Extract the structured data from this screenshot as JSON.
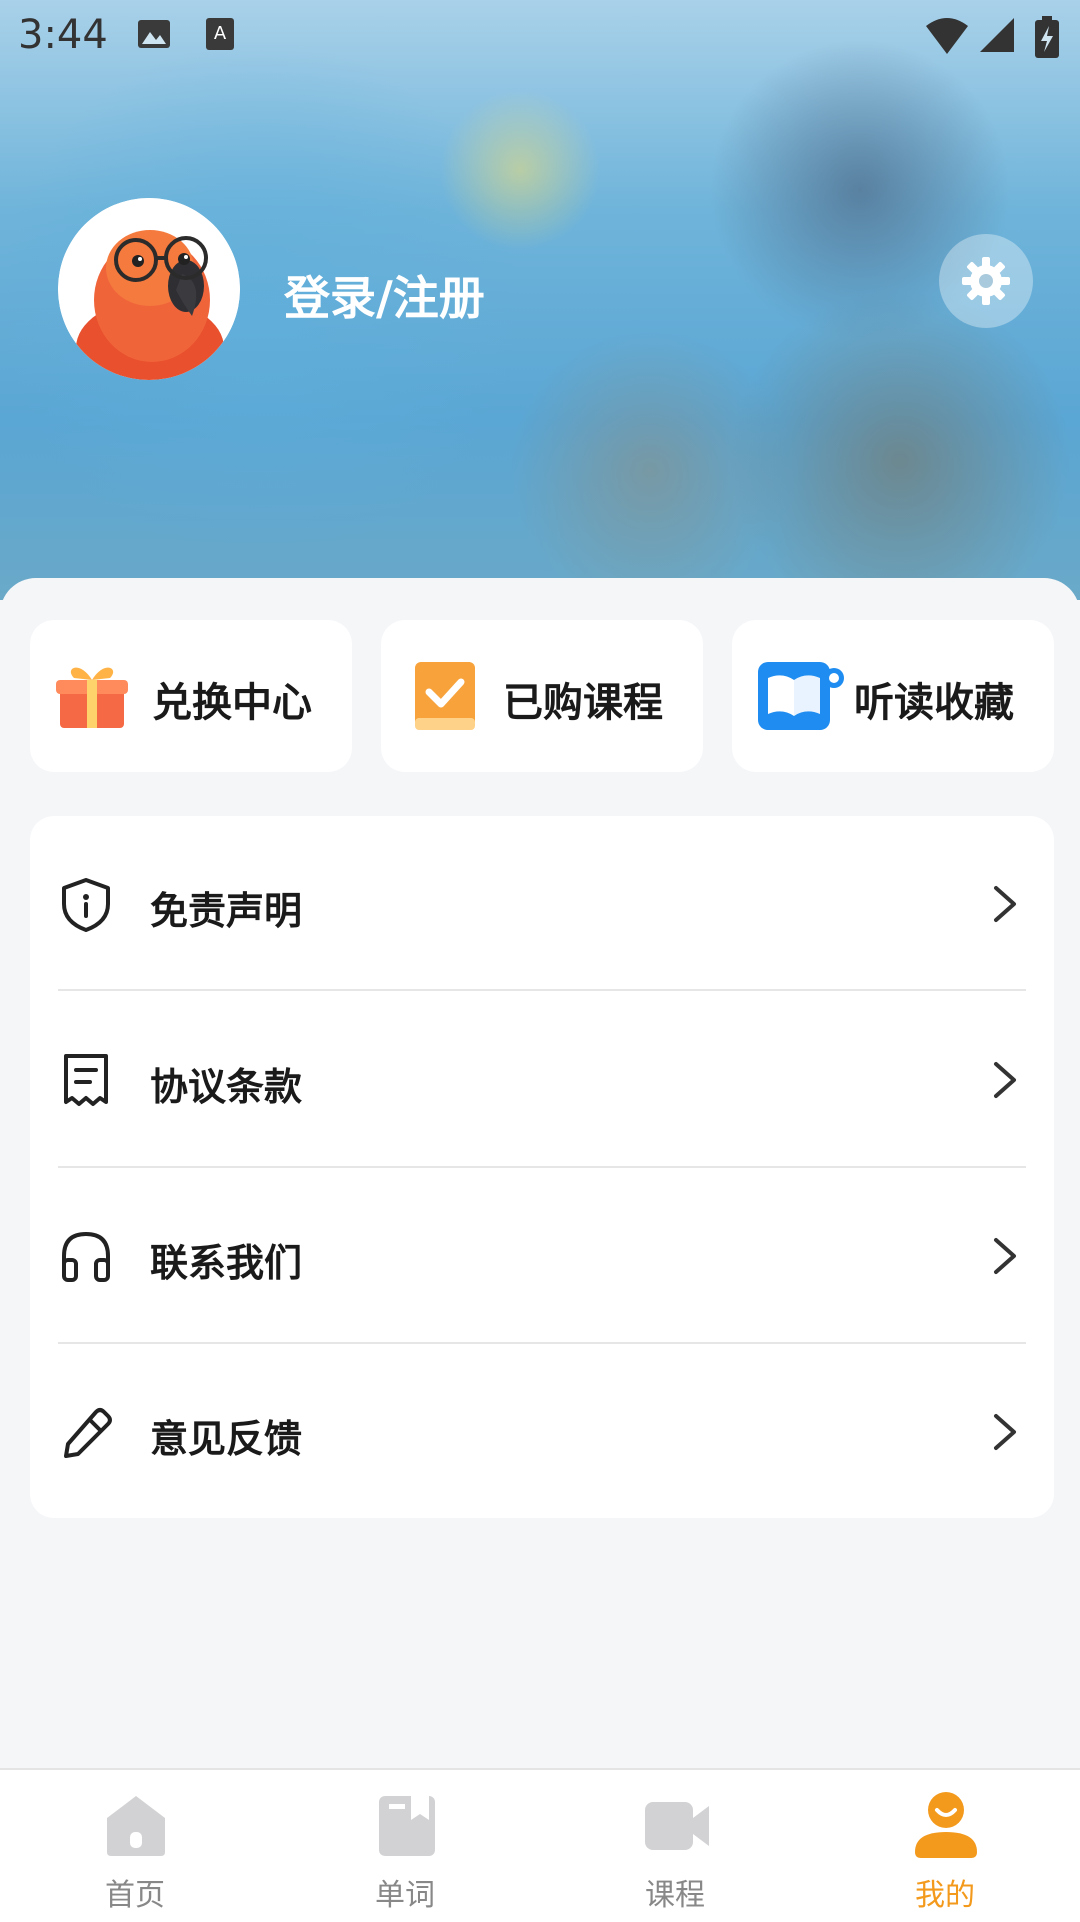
{
  "status_bar": {
    "time": "3:44"
  },
  "header": {
    "login_label": "登录/注册"
  },
  "quick_actions": [
    {
      "label": "兑换中心",
      "icon": "gift-icon"
    },
    {
      "label": "已购课程",
      "icon": "purchased-course-icon"
    },
    {
      "label": "听读收藏",
      "icon": "listen-read-favorites-icon"
    }
  ],
  "menu": [
    {
      "label": "免责声明",
      "icon": "shield-info-icon"
    },
    {
      "label": "协议条款",
      "icon": "document-icon"
    },
    {
      "label": "联系我们",
      "icon": "headphones-icon"
    },
    {
      "label": "意见反馈",
      "icon": "pencil-icon"
    }
  ],
  "tabbar": {
    "items": [
      {
        "label": "首页",
        "icon": "home-icon"
      },
      {
        "label": "单词",
        "icon": "word-book-icon"
      },
      {
        "label": "课程",
        "icon": "video-camera-icon"
      },
      {
        "label": "我的",
        "icon": "profile-icon",
        "active": true
      }
    ],
    "active_color": "#f39a1d",
    "inactive_color": "#888888"
  }
}
